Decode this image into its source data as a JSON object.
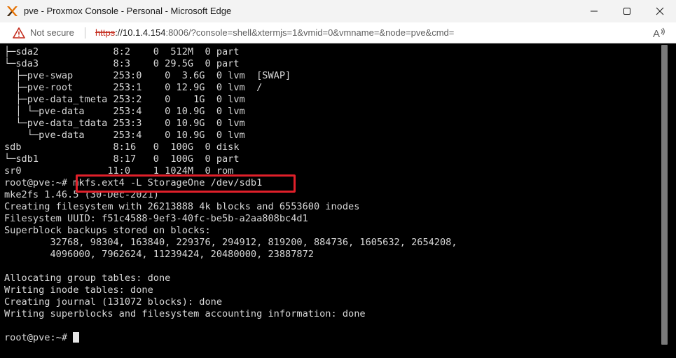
{
  "window": {
    "title": "pve - Proxmox Console - Personal - Microsoft Edge",
    "icon": "proxmox-x-logo"
  },
  "addressbar": {
    "security_label": "Not secure",
    "url_scheme": "https",
    "url_host": "://10.1.4.154",
    "url_rest": ":8006/?console=shell&xtermjs=1&vmid=0&vmname=&node=pve&cmd=",
    "read_aloud_label": "A"
  },
  "colors": {
    "terminal_bg": "#000000",
    "terminal_fg": "#d8d8d8",
    "highlight": "#e0202a",
    "not_secure": "#c42b1c"
  },
  "terminal": {
    "lines": [
      "├─sda2             8:2    0  512M  0 part",
      "└─sda3             8:3    0 29.5G  0 part",
      "  ├─pve-swap       253:0    0  3.6G  0 lvm  [SWAP]",
      "  ├─pve-root       253:1    0 12.9G  0 lvm  /",
      "  ├─pve-data_tmeta 253:2    0    1G  0 lvm",
      "  │ └─pve-data     253:4    0 10.9G  0 lvm",
      "  └─pve-data_tdata 253:3    0 10.9G  0 lvm",
      "    └─pve-data     253:4    0 10.9G  0 lvm",
      "sdb                8:16   0  100G  0 disk",
      "└─sdb1             8:17   0  100G  0 part",
      "sr0               11:0    1 1024M  0 rom",
      "root@pve:~# mkfs.ext4 -L StorageOne /dev/sdb1",
      "mke2fs 1.46.5 (30-Dec-2021)",
      "Creating filesystem with 26213888 4k blocks and 6553600 inodes",
      "Filesystem UUID: f51c4588-9ef3-40fc-be5b-a2aa808bc4d1",
      "Superblock backups stored on blocks:",
      "        32768, 98304, 163840, 229376, 294912, 819200, 884736, 1605632, 2654208,",
      "        4096000, 7962624, 11239424, 20480000, 23887872",
      "",
      "Allocating group tables: done",
      "Writing inode tables: done",
      "Creating journal (131072 blocks): done",
      "Writing superblocks and filesystem accounting information: done",
      "",
      "root@pve:~# "
    ]
  }
}
